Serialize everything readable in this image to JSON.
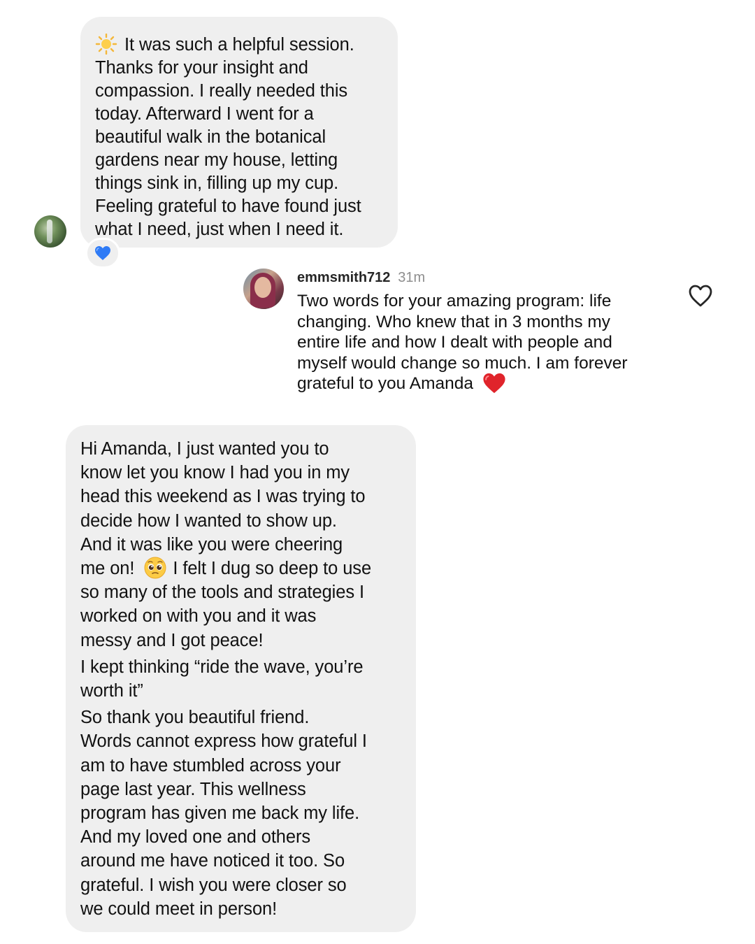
{
  "bubble1": {
    "lines": [
      "It was such a helpful session.",
      "Thanks for your insight and",
      "compassion. I really needed this",
      "today. Afterward I went for a",
      "beautiful walk in the botanical",
      "gardens near my house, letting",
      "things sink in, filling up my cup.",
      "Feeling grateful to have found just",
      "what I need, just when I need it."
    ],
    "leading_emoji": "sun-emoji",
    "reaction": "blue-heart-emoji"
  },
  "comment": {
    "username": "emmsmith712",
    "time": "31m",
    "lines": [
      "Two words for your amazing program: life",
      "changing. Who knew that in 3 months my",
      "entire life and how I dealt with people and",
      "myself would change so much. I am forever",
      "grateful to you Amanda"
    ],
    "trailing_emoji": "red-heart-emoji",
    "like_icon": "heart-outline-icon"
  },
  "bubble2": {
    "lines": [
      "Hi Amanda, I just wanted you to",
      "know let you know I had you in my",
      "head this weekend as I was trying to",
      "decide how I wanted to show up.",
      "And it was like you were cheering",
      "me on!",
      "I felt I dug so deep to use",
      "so many of the tools and strategies I",
      "worked on with you and it was",
      "messy and I got peace!",
      "I kept thinking “ride the wave, you’re",
      "worth it”",
      "So thank you beautiful friend.",
      "Words cannot express how grateful I",
      "am to have stumbled across your",
      "page last year.  This wellness",
      "program has given me back my life.",
      "And my loved one and others",
      "around me have noticed it too.  So",
      "grateful.  I wish you were closer so",
      "we could meet in person!"
    ],
    "inline_emoji": "pleading-face-emoji"
  },
  "colors": {
    "bubble": "#efefef",
    "text": "#111111",
    "muted": "#8e8e8e",
    "blue_heart": "#2f7bf6",
    "red_heart": "#e0242b"
  }
}
